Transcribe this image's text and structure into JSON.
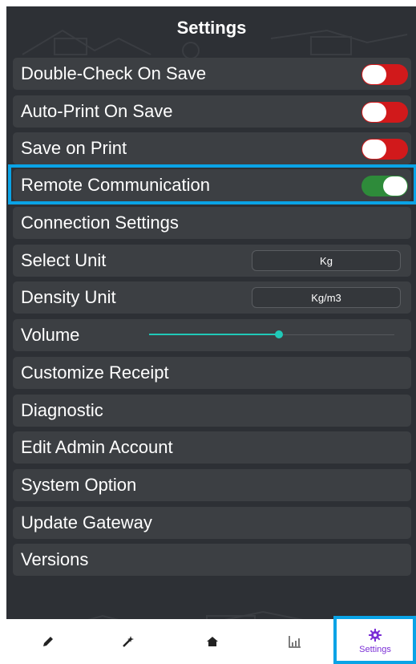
{
  "header": {
    "title": "Settings"
  },
  "settings": {
    "double_check": {
      "label": "Double-Check On Save",
      "enabled": false
    },
    "auto_print": {
      "label": "Auto-Print On Save",
      "enabled": false
    },
    "save_on_print": {
      "label": "Save on Print",
      "enabled": false
    },
    "remote_comm": {
      "label": "Remote Communication",
      "enabled": true
    },
    "connection": {
      "label": "Connection Settings"
    },
    "select_unit": {
      "label": "Select Unit",
      "value": "Kg"
    },
    "density_unit": {
      "label": "Density Unit",
      "value": "Kg/m3"
    },
    "volume": {
      "label": "Volume",
      "level": 0.53
    },
    "customize_receipt": {
      "label": "Customize Receipt"
    },
    "diagnostic": {
      "label": "Diagnostic"
    },
    "edit_admin": {
      "label": "Edit Admin Account"
    },
    "system_option": {
      "label": "System Option"
    },
    "update_gateway": {
      "label": "Update Gateway"
    },
    "versions": {
      "label": "Versions"
    }
  },
  "nav": {
    "items": [
      {
        "icon": "pencil-icon"
      },
      {
        "icon": "wand-icon"
      },
      {
        "icon": "home-icon"
      },
      {
        "icon": "chart-icon"
      },
      {
        "icon": "gear-icon",
        "label": "Settings"
      }
    ]
  },
  "colors": {
    "toggle_off": "#d1191b",
    "toggle_on": "#2e8b3a",
    "accent": "#20c9b8",
    "highlight": "#0aa3e6",
    "nav_active": "#7b2fd6"
  }
}
